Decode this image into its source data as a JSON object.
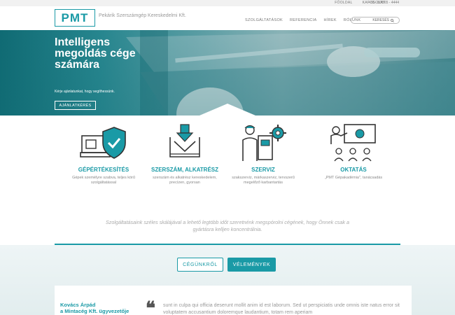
{
  "topbar": {
    "links": [
      "FŐOLDAL",
      "KAPCSOLAT"
    ],
    "phone": "+36 - 30/565 - 4444"
  },
  "header": {
    "logo": "PMT",
    "company": "Pekárik Szerszámgép Kereskedelmi Kft.",
    "nav": [
      "SZOLGÁLTATÁSOK",
      "REFERENCIA",
      "HÍREK",
      "RÓLUNK"
    ],
    "search_label": "KERESÉS",
    "search_icon": "magnifier-icon"
  },
  "hero": {
    "title": "Intelligens megoldás cége számára",
    "subtitle": "Kérje ajánlatunkat, hogy segíthessünk.",
    "cta": "AJÁNLATKÉRÉS"
  },
  "services": [
    {
      "title": "GÉPÉRTÉKESÍTÉS",
      "desc": "Gépek személyre szabva, teljes körű szolgáltatással",
      "icon": "machine-shield-icon"
    },
    {
      "title": "SZERSZÁM, ALKATRÉSZ",
      "desc": "szerszám és alkatrész kereskedelem, precízen, gyorsan",
      "icon": "press-tool-icon"
    },
    {
      "title": "SZERVIZ",
      "desc": "szakszerviz, márkaszerviz, tervszerű megelőző karbantartás",
      "icon": "technician-gear-icon"
    },
    {
      "title": "OKTATÁS",
      "desc": "„PMT Gépakadémia\", tanácsadás",
      "icon": "training-class-icon"
    }
  ],
  "quote": "Szolgáltatásaink széles skálájával a lehető legtöbb időt szeretnénk megspórolni cégének, hogy Önnek csak a gyártásra kelljen koncentrálnia.",
  "tabs": [
    "CÉGÜNKRŐL",
    "VÉLEMÉNYEK"
  ],
  "testimonial": {
    "name_line1": "Kovács Árpád",
    "name_line2": "a Mintacég Kft. ügyvezetője",
    "text": "sunt in culpa qui officia deserunt mollit anim id est laborum. Sed ut perspiciatis unde omnis iste natus error sit voluptatem accusantium doloremque laudantium, totam rem aperiam"
  },
  "colors": {
    "accent": "#1a9aa6",
    "hero_dark": "#0f6a73"
  }
}
